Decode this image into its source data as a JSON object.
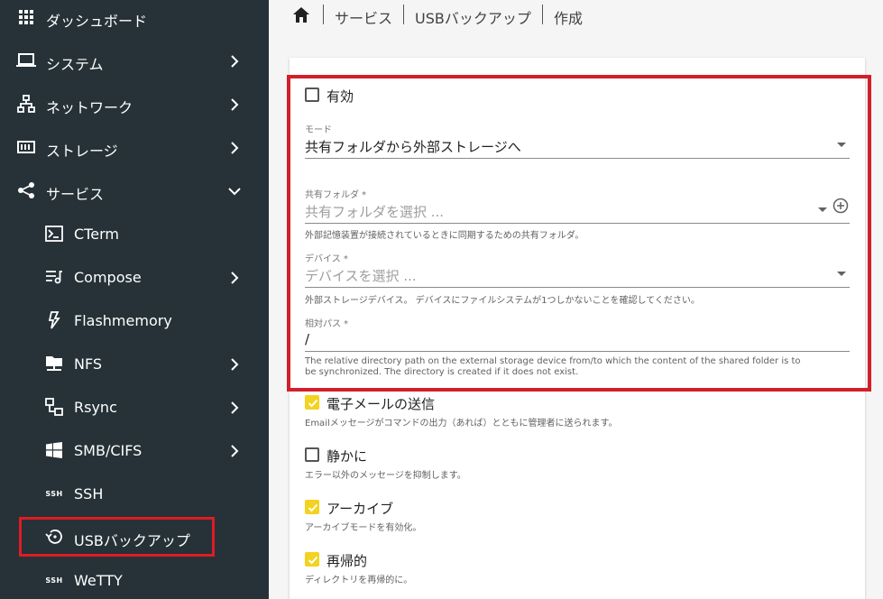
{
  "sidebar": {
    "items": [
      {
        "label": "ダッシュボード",
        "icon": "grid-icon"
      },
      {
        "label": "システム",
        "icon": "laptop-icon"
      },
      {
        "label": "ネットワーク",
        "icon": "network-icon"
      },
      {
        "label": "ストレージ",
        "icon": "storage-icon"
      },
      {
        "label": "サービス",
        "icon": "share-icon"
      },
      {
        "label": "CTerm",
        "icon": "terminal-icon"
      },
      {
        "label": "Compose",
        "icon": "playlist-icon"
      },
      {
        "label": "Flashmemory",
        "icon": "flash-icon"
      },
      {
        "label": "NFS",
        "icon": "folder-network-icon"
      },
      {
        "label": "Rsync",
        "icon": "sync-icon"
      },
      {
        "label": "SMB/CIFS",
        "icon": "windows-icon"
      },
      {
        "label": "SSH",
        "icon": "ssh-icon"
      },
      {
        "label": "USBバックアップ",
        "icon": "backup-restore-icon"
      },
      {
        "label": "WeTTY",
        "icon": "ssh-icon"
      }
    ],
    "ssh_icon_text": "SSH"
  },
  "breadcrumb": {
    "items": [
      "サービス",
      "USBバックアップ",
      "作成"
    ]
  },
  "form": {
    "enabled": {
      "label": "有効",
      "checked": false
    },
    "mode": {
      "label": "モード",
      "value": "共有フォルダから外部ストレージへ"
    },
    "shared_folder": {
      "label": "共有フォルダ *",
      "placeholder": "共有フォルダを選択 ...",
      "hint": "外部記憶装置が接続されているときに同期するための共有フォルダ。"
    },
    "device": {
      "label": "デバイス *",
      "placeholder": "デバイスを選択 ...",
      "hint": "外部ストレージデバイス。 デバイスにファイルシステムが1つしかないことを確認してください。"
    },
    "relative_path": {
      "label": "相対パス *",
      "value": "/",
      "hint": "The relative directory path on the external storage device from/to which the content of the shared folder is to be synchronized. The directory is created if it does not exist."
    },
    "send_email": {
      "label": "電子メールの送信",
      "checked": true,
      "hint": "Emailメッセージがコマンドの出力（あれば）とともに管理者に送られます。"
    },
    "quiet": {
      "label": "静かに",
      "checked": false,
      "hint": "エラー以外のメッセージを抑制します。"
    },
    "archive": {
      "label": "アーカイブ",
      "checked": true,
      "hint": "アーカイブモードを有効化。"
    },
    "recursive": {
      "label": "再帰的",
      "checked": true,
      "hint": "ディレクトリを再帰的に。"
    }
  },
  "colors": {
    "sidebar_bg": "#263238",
    "accent_yellow": "#f4d21e",
    "highlight_red": "#d21f2b"
  }
}
